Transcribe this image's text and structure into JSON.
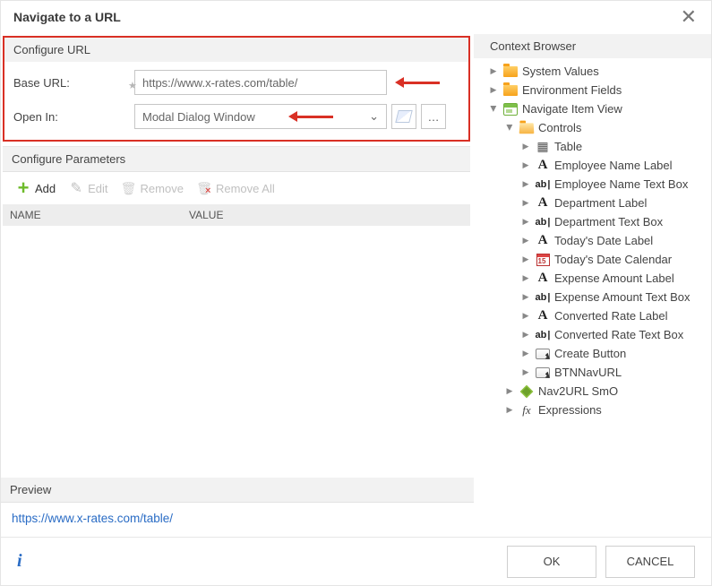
{
  "header": {
    "title": "Navigate to a URL"
  },
  "configureUrl": {
    "title": "Configure URL",
    "baseUrlLabel": "Base URL:",
    "baseUrlValue": "https://www.x-rates.com/table/",
    "openInLabel": "Open In:",
    "openInValue": "Modal Dialog Window",
    "moreBtn": "…"
  },
  "configureParams": {
    "title": "Configure Parameters",
    "addLabel": "Add",
    "editLabel": "Edit",
    "removeLabel": "Remove",
    "removeAllLabel": "Remove All",
    "colName": "NAME",
    "colValue": "VALUE"
  },
  "preview": {
    "title": "Preview",
    "url": "https://www.x-rates.com/table/"
  },
  "contextBrowser": {
    "title": "Context Browser",
    "systemValues": "System Values",
    "environmentFields": "Environment Fields",
    "navigateItemView": "Navigate Item View",
    "controls": "Controls",
    "items": [
      {
        "icon": "table",
        "label": "Table"
      },
      {
        "icon": "A",
        "label": "Employee Name Label"
      },
      {
        "icon": "ab",
        "label": "Employee Name Text Box"
      },
      {
        "icon": "A",
        "label": "Department Label"
      },
      {
        "icon": "ab",
        "label": "Department Text Box"
      },
      {
        "icon": "A",
        "label": "Today's Date Label"
      },
      {
        "icon": "cal",
        "label": "Today's Date Calendar"
      },
      {
        "icon": "A",
        "label": "Expense Amount Label"
      },
      {
        "icon": "ab",
        "label": "Expense Amount Text Box"
      },
      {
        "icon": "A",
        "label": "Converted Rate Label"
      },
      {
        "icon": "ab",
        "label": "Converted Rate Text Box"
      },
      {
        "icon": "btn",
        "label": "Create Button"
      },
      {
        "icon": "btn",
        "label": "BTNNavURL"
      }
    ],
    "nav2url": "Nav2URL SmO",
    "expressions": "Expressions"
  },
  "footer": {
    "ok": "OK",
    "cancel": "CANCEL"
  }
}
